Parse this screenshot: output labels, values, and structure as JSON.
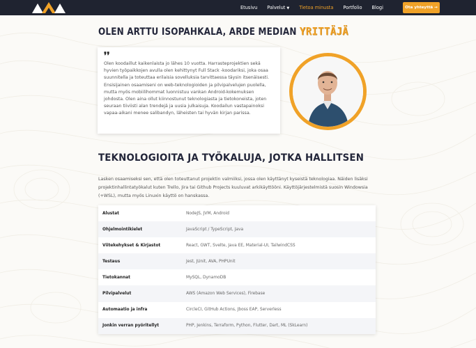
{
  "nav": {
    "links": [
      {
        "label": "Etusivu",
        "active": false
      },
      {
        "label": "Palvelut",
        "active": false,
        "dropdown": true
      },
      {
        "label": "Tietoa minusta",
        "active": true
      },
      {
        "label": "Portfolio",
        "active": false
      },
      {
        "label": "Blogi",
        "active": false
      }
    ],
    "cta_label": "Ota yhteyttä →"
  },
  "about": {
    "heading": "OLEN ARTTU ISOPAHKALA, ARDE MEDIAN",
    "heading_accent": "YRITTÄJÄ",
    "quote_mark": "❜❜",
    "quote_text": "Olen koodaillut kaikenlaista jo lähes 10 vuotta. Harrasteprojektien sekä hyvien työpaikkojen avulla olen kehittynyt Full Stack -koodariksi, joka osaa suunnitella ja toteuttaa erilaisia sovelluksia tarvittaessa täysin itsenäisesti. Ensisijainen osaamiseni on web-teknologioiden ja pilvipalvelujen puolella, mutta myös mobiilihommat luonnistuu vankan Android-kokemuksen johdosta. Olen aina ollut kiinnostunut teknologiasta ja tietokoneista, joten seuraan tiiviisti alan trendejä ja uusia julkaisuja. Koodailun vastapainoksi vapaa-aikani menee salibandyn, läheisten tai hyvän kirjan parissa."
  },
  "tech": {
    "heading": "TEKNOLOGIOITA JA TYÖKALUJA, JOTKA HALLITSEN",
    "paragraph": "Lasken osaamiseksi sen, että olen toteuttanut projektin valmiiksi, jossa olen käyttänyt kyseistä teknologiaa. Näiden lisäksi projektinhallintatyökalut kuten Trello, Jira tai Github Projects kuuluvat arkikäyttööni. Käyttöjärjestelmistä suosin Windowsia (+WSL), mutta myös Linuxin käyttö on hanskassa.",
    "rows": [
      {
        "key": "Alustat",
        "value": "NodeJS, JVM, Android"
      },
      {
        "key": "Ohjelmointikielet",
        "value": "JavaScript / TypeScript, Java"
      },
      {
        "key": "Viitekehykset & Kirjastot",
        "value": "React, GWT, Svelte, Java EE, Material-UI, TailwindCSS"
      },
      {
        "key": "Testaus",
        "value": "Jest, JUnit, AVA, PHPUnit"
      },
      {
        "key": "Tietokannat",
        "value": "MySQL, DynamoDB"
      },
      {
        "key": "Pilvipalvelut",
        "value": "AWS (Amazon Web Services), Firebase"
      },
      {
        "key": "Automaatio ja infra",
        "value": "CircleCI, GitHub Actions, Jboss EAP, Serverless"
      },
      {
        "key": "Jonkin verran pyöritellyt",
        "value": "PHP, Jenkins, Terraform, Python, Flutter, Dart, ML (SkLearn)"
      }
    ]
  },
  "colors": {
    "accent": "#f0a228",
    "nav_bg": "#1f2330",
    "heading": "#23263a"
  }
}
